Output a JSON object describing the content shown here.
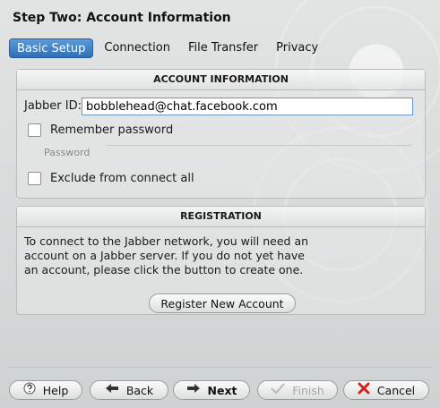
{
  "window": {
    "title": "Step Two: Account Information"
  },
  "tabs": [
    {
      "label": "Basic Setup",
      "active": true
    },
    {
      "label": "Connection",
      "active": false
    },
    {
      "label": "File Transfer",
      "active": false
    },
    {
      "label": "Privacy",
      "active": false
    }
  ],
  "account": {
    "header": "ACCOUNT INFORMATION",
    "jid_label": "Jabber ID:",
    "jid_value": "bobblehead@chat.facebook.com",
    "remember_label": "Remember password",
    "remember_checked": false,
    "password_label": "Password",
    "exclude_label": "Exclude from connect all",
    "exclude_checked": false
  },
  "registration": {
    "header": "REGISTRATION",
    "description": "To connect to the Jabber network, you will need an account on a Jabber server.  If you do not yet have an account, please click the button to create one.",
    "button_label": "Register New Account"
  },
  "footer": {
    "help": "Help",
    "back": "Back",
    "next": "Next",
    "finish": "Finish",
    "cancel": "Cancel"
  },
  "icons": {
    "help": "help-icon",
    "back": "arrow-left-icon",
    "next": "arrow-right-icon",
    "finish": "check-icon",
    "cancel": "x-icon"
  },
  "colors": {
    "accent": "#3a7cc4",
    "cancel": "#d62020"
  }
}
